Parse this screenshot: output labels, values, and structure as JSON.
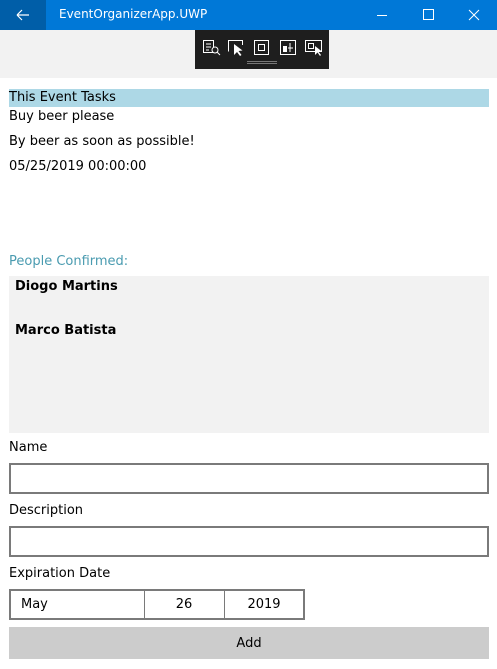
{
  "window": {
    "title": "EventOrganizerApp.UWP",
    "accent_color": "#0078d7",
    "icons": {
      "back": "back-arrow-icon",
      "minimize": "minimize-icon",
      "maximize": "maximize-icon",
      "close": "close-icon"
    }
  },
  "debug_toolbar": {
    "tools": [
      "live-visual-tree-icon",
      "select-element-icon",
      "display-layout-adorners-icon",
      "track-focus-icon",
      "preview-selection-icon"
    ]
  },
  "event": {
    "section_title": "This Event Tasks",
    "task_name": "Buy beer please",
    "task_description": "By beer as soon as possible!",
    "task_expiration": "05/25/2019 00:00:00",
    "header_color": "#add8e6"
  },
  "people": {
    "label": "People Confirmed:",
    "label_color": "#4a9bb0",
    "names": [
      "Diogo Martins",
      "Marco Batista"
    ]
  },
  "form": {
    "name_label": "Name",
    "name_value": "",
    "description_label": "Description",
    "description_value": "",
    "expiration_label": "Expiration Date",
    "expiration": {
      "month": "May",
      "day": "26",
      "year": "2019"
    },
    "add_label": "Add"
  }
}
